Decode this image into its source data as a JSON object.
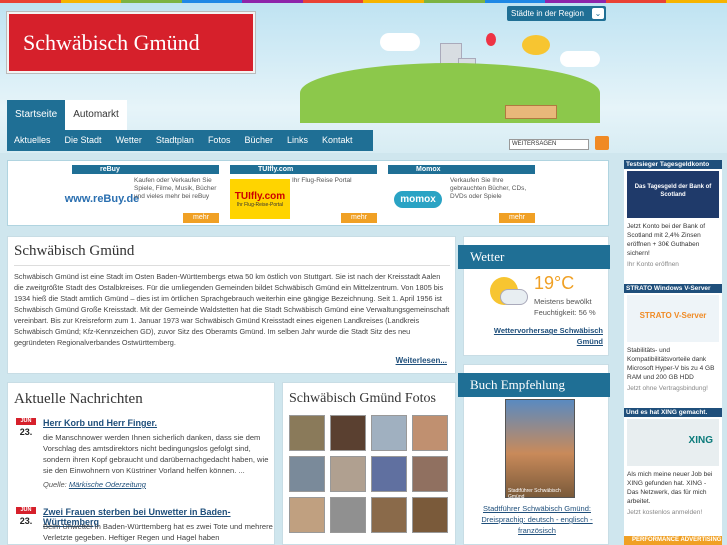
{
  "colors": {
    "stripe": [
      "#e94235",
      "#f6b400",
      "#7cb342",
      "#1e88e5",
      "#8e24aa",
      "#e94235",
      "#f6b400",
      "#7cb342",
      "#1e88e5",
      "#8e24aa",
      "#e94235",
      "#f6b400"
    ]
  },
  "header": {
    "logo": "Schwäbisch Gmünd",
    "region_label": "Städte in der Region",
    "share_label": "WEITERSAGEN"
  },
  "nav": {
    "tabs": [
      "Startseite",
      "Automarkt"
    ],
    "items": [
      "Aktuelles",
      "Die Stadt",
      "Wetter",
      "Stadtplan",
      "Fotos",
      "Bücher",
      "Links",
      "Kontakt"
    ]
  },
  "ads": [
    {
      "title": "reBuy",
      "logo": "www.reBuy.de",
      "text": "Kaufen oder Verkaufen Sie Spiele, Filme, Musik, Bücher und vieles mehr bei reBuy",
      "more": "mehr"
    },
    {
      "title": "TUIfly.com",
      "logo": "TUIfly.com",
      "tagline": "Ihr Flug-Reise-Portal",
      "text": "Ihr Flug-Reise Portal",
      "more": "mehr"
    },
    {
      "title": "Momox",
      "logo": "momox",
      "text": "Verkaufen Sie Ihre gebrauchten Bücher, CDs, DVDs oder Spiele",
      "more": "mehr"
    }
  ],
  "intro": {
    "title": "Schwäbisch Gmünd",
    "text": "Schwäbisch Gmünd ist eine Stadt im Osten Baden-Württembergs etwa 50 km östlich von Stuttgart. Sie ist nach der Kreisstadt Aalen die zweitgrößte Stadt des Ostalbkreises. Für die umliegenden Gemeinden bildet Schwäbisch Gmünd ein Mittelzentrum. Von 1805 bis 1934 hieß die Stadt amtlich Gmünd – dies ist im örtlichen Sprachgebrauch weiterhin eine gängige Bezeichnung. Seit 1. April 1956 ist Schwäbisch Gmünd Große Kreisstadt. Mit der Gemeinde Waldstetten hat die Stadt Schwäbisch Gmünd eine Verwaltungsgemeinschaft vereinbart. Bis zur Kreisreform zum 1. Januar 1973 war Schwäbisch Gmünd Kreisstadt eines eigenen Landkreises (Landkreis Schwäbisch Gmünd; Kfz-Kennzeichen GD), zuvor Sitz des Oberamts Gmünd. Im selben Jahr wurde die Stadt Sitz des neu gegründeten Regionalverbandes Ostwürttemberg.",
    "more": "Weiterlesen..."
  },
  "weather": {
    "title": "Wetter",
    "temp": "19°C",
    "condition": "Meistens bewölkt",
    "humidity": "Feuchtigkeit: 56 %",
    "link": "Wettervorhersage Schwäbisch Gmünd"
  },
  "book": {
    "title": "Buch Empfehlung",
    "cover_text": "Stadtführer Schwäbisch Gmünd",
    "link": "Stadtführer Schwäbisch Gmünd: Dreisprachig: deutsch - englisch - französisch"
  },
  "news": {
    "title": "Aktuelle Nachrichten",
    "items": [
      {
        "month": "JUN",
        "day": "23.",
        "title": "Herr Korb und Herr Finger.",
        "body": "die Manschnower werden Ihnen sicherlich danken, dass sie dem Vorschlag des amtsdirektors nicht bedingungslos gefolgt sind, sondern ihren Kopf gebraucht und darübernachgedacht haben, wie sie den Einwohnern von Küstriner Vorland helfen können. ...",
        "source_label": "Quelle:",
        "source": "Märkische Oderzeitung"
      },
      {
        "month": "JUN",
        "day": "23.",
        "title": "Zwei Frauen sterben bei Unwetter in Baden-Württemberg",
        "body": "Beim Unwetter in Baden-Württemberg hat es zwei Tote und mehrere Verletzte gegeben. Heftiger Regen und Hagel haben"
      }
    ]
  },
  "photos": {
    "title": "Schwäbisch Gmünd Fotos",
    "tiles": [
      "#8a7a5a",
      "#5a4030",
      "#a0b0c0",
      "#c09070",
      "#7a8a9a",
      "#b0a090",
      "#6070a0",
      "#907060",
      "#c0a080",
      "#909090",
      "#8a6a4a",
      "#7a5a3a"
    ]
  },
  "sidebar": [
    {
      "head": "Testsieger Tagesgeldkonto",
      "img": "Das Tagesgeld der Bank of Scotland",
      "text": "Jetzt Konto bei der Bank of Scotland mit 2,4% Zinsen eröffnen + 30€ Guthaben sichern!",
      "link": "Ihr Konto eröffnen"
    },
    {
      "head": "STRATO Windows V-Server",
      "img": "STRATO V-Server",
      "text": "Stabilitäts- und Kompatibilitätsvorteile dank Microsoft Hyper-V bis zu 4 GB RAM und 200 GB HDD",
      "link": "Jetzt ohne Vertragsbindung!"
    },
    {
      "head": "Und es hat XING gemacht.",
      "img": "XING",
      "text": "Als mich meine neuer Job bei XING gefunden hat. XING - Das Netzwerk, das für mich arbeitet.",
      "link": "Jetzt kostenlos anmelden!"
    }
  ],
  "sidebar_footer": "PERFORMANCE ADVERTISING"
}
